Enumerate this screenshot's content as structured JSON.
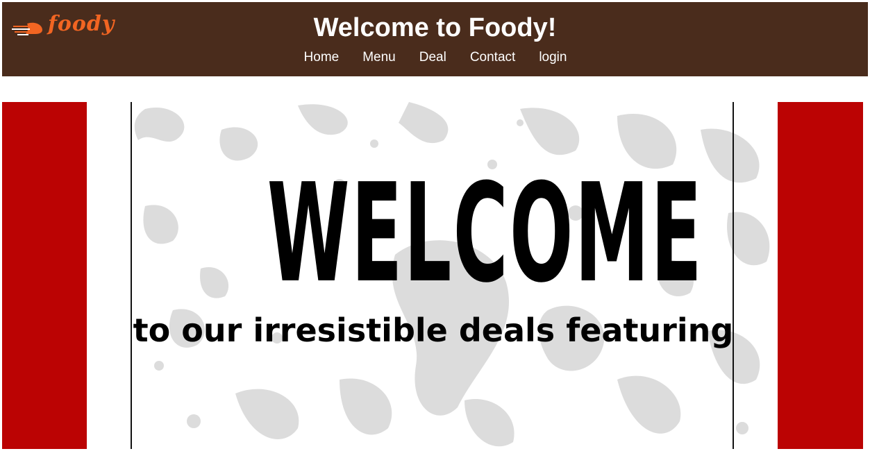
{
  "brand": {
    "logo_text": "foody",
    "logo_icon": "delivery-speed-icon",
    "brand_color": "#f26522"
  },
  "header": {
    "title": "Welcome to Foody!",
    "background": "#4a2c1c"
  },
  "nav": {
    "items": [
      {
        "label": "Home"
      },
      {
        "label": "Menu"
      },
      {
        "label": "Deal"
      },
      {
        "label": "Contact"
      },
      {
        "label": "login"
      }
    ]
  },
  "banner": {
    "headline": "WELCOME",
    "subline": "to our irresistible deals featuring",
    "accent": "#bb0303"
  }
}
